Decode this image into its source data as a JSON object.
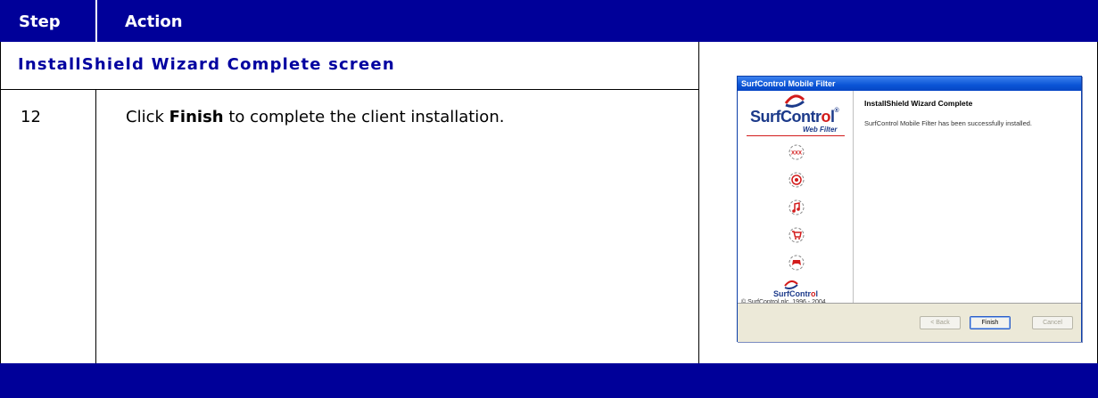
{
  "header": {
    "step_label": "Step",
    "action_label": "Action"
  },
  "section": {
    "title": "InstallShield Wizard Complete screen"
  },
  "step": {
    "number": "12",
    "text_before": "Click ",
    "text_bold": "Finish",
    "text_after": " to complete the client installation."
  },
  "wizard": {
    "title": "SurfControl Mobile Filter",
    "logo_name_prefix": "SurfContr",
    "logo_name_o": "o",
    "logo_name_suffix": "l",
    "logo_reg": "®",
    "logo_sub": "Web Filter",
    "small_logo_prefix": "SurfContr",
    "small_logo_o": "o",
    "small_logo_suffix": "l",
    "copyright": "© SurfControl plc, 1996 - 2004",
    "heading": "InstallShield Wizard Complete",
    "body": "SurfControl Mobile Filter has been successfully installed.",
    "buttons": {
      "back": "< Back",
      "finish": "Finish",
      "cancel": "Cancel"
    },
    "category_icons": [
      "xxx-icon",
      "target-icon",
      "music-note-icon",
      "shopping-cart-icon",
      "game-icon"
    ]
  },
  "colors": {
    "header_bg": "#000099",
    "section_title": "#0000a0",
    "brand_red": "#d21b1b",
    "brand_blue": "#1c3a8a"
  }
}
